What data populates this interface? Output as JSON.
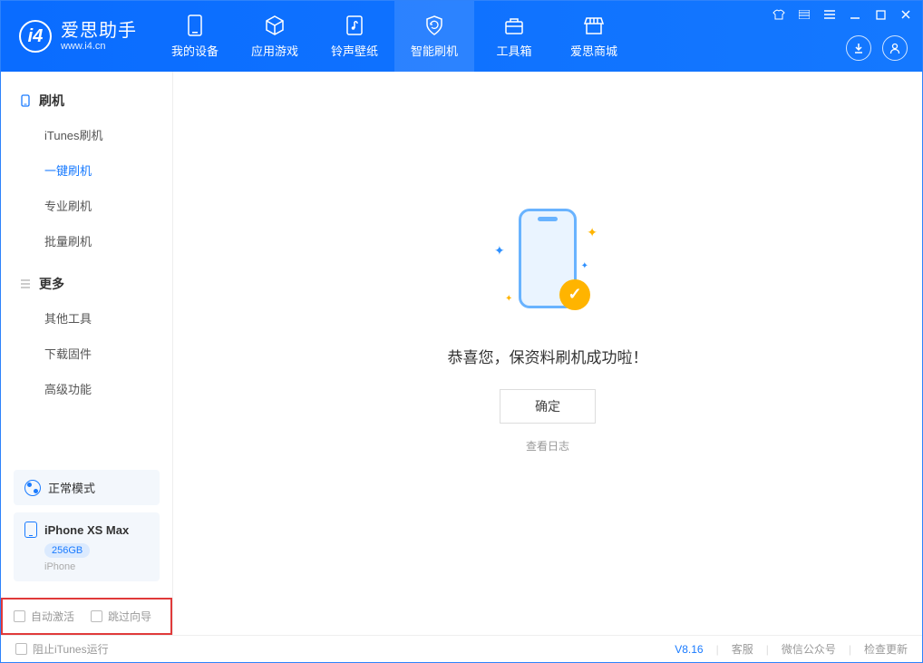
{
  "app": {
    "title": "爱思助手",
    "subtitle": "www.i4.cn"
  },
  "nav": {
    "items": [
      {
        "label": "我的设备"
      },
      {
        "label": "应用游戏"
      },
      {
        "label": "铃声壁纸"
      },
      {
        "label": "智能刷机"
      },
      {
        "label": "工具箱"
      },
      {
        "label": "爱思商城"
      }
    ]
  },
  "sidebar": {
    "sections": [
      {
        "title": "刷机",
        "items": [
          "iTunes刷机",
          "一键刷机",
          "专业刷机",
          "批量刷机"
        ]
      },
      {
        "title": "更多",
        "items": [
          "其他工具",
          "下载固件",
          "高级功能"
        ]
      }
    ],
    "mode_label": "正常模式",
    "device": {
      "name": "iPhone XS Max",
      "storage": "256GB",
      "type": "iPhone"
    },
    "checkboxes": {
      "auto_activate": "自动激活",
      "skip_guide": "跳过向导"
    }
  },
  "main": {
    "success_msg": "恭喜您，保资料刷机成功啦！",
    "confirm": "确定",
    "view_log": "查看日志"
  },
  "footer": {
    "block_itunes": "阻止iTunes运行",
    "version": "V8.16",
    "links": [
      "客服",
      "微信公众号",
      "检查更新"
    ]
  }
}
